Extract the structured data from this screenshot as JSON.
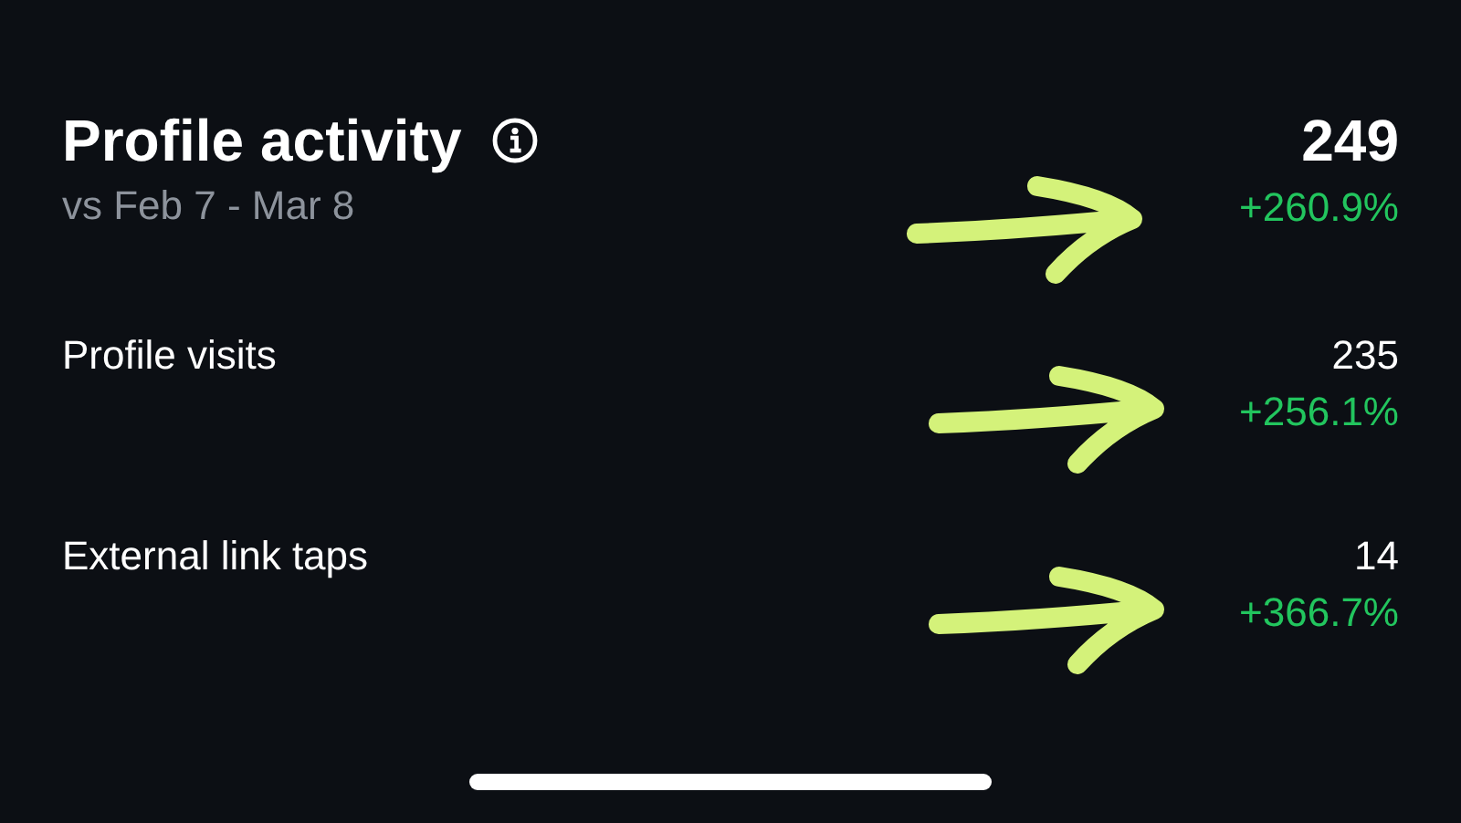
{
  "summary": {
    "title": "Profile activity",
    "subtitle": "vs Feb 7 - Mar 8",
    "value": "249",
    "change": "+260.9%",
    "marked": true
  },
  "metrics": [
    {
      "label": "Profile visits",
      "value": "235",
      "change": "+256.1%",
      "marked": true
    },
    {
      "label": "External link taps",
      "value": "14",
      "change": "+366.7%",
      "marked": true
    }
  ]
}
